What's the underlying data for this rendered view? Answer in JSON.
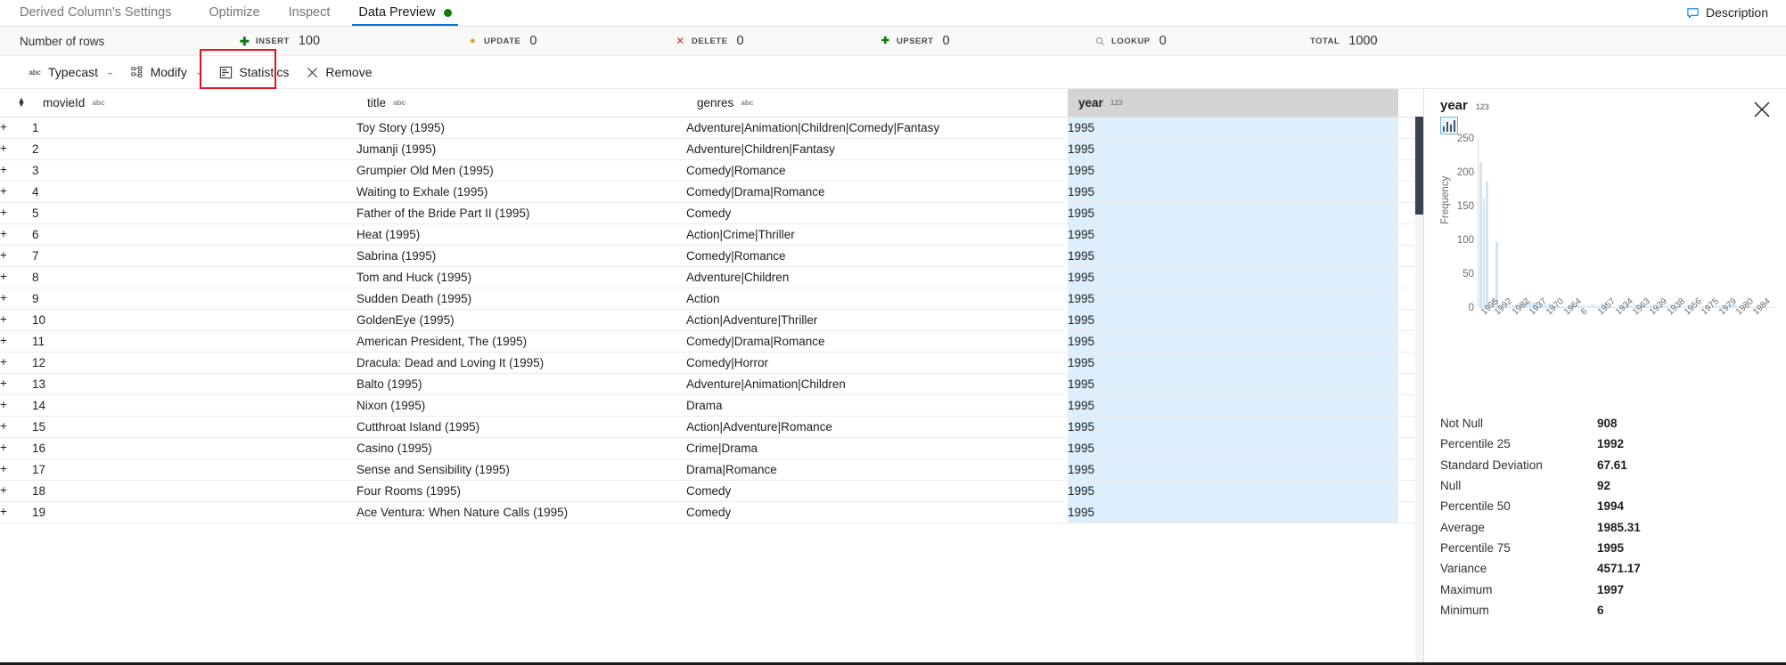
{
  "tabs": [
    {
      "label": "Derived Column's Settings",
      "active": false,
      "dot": false
    },
    {
      "label": "Optimize",
      "active": false,
      "dot": false
    },
    {
      "label": "Inspect",
      "active": false,
      "dot": false
    },
    {
      "label": "Data Preview",
      "active": true,
      "dot": true
    }
  ],
  "header": {
    "description_label": "Description"
  },
  "rowcount": {
    "label": "Number of rows",
    "metrics": [
      {
        "name": "INSERT",
        "value": "100",
        "icon": "plus-icon",
        "color": "#107c10",
        "glyph": "✚"
      },
      {
        "name": "UPDATE",
        "value": "0",
        "icon": "pencil-dot-icon",
        "color": "#d8a200",
        "glyph": "✦"
      },
      {
        "name": "DELETE",
        "value": "0",
        "icon": "cross-icon",
        "color": "#d13438",
        "glyph": "✕"
      },
      {
        "name": "UPSERT",
        "value": "0",
        "icon": "upsert-plus-icon",
        "color": "#107c10",
        "glyph": "✛"
      },
      {
        "name": "LOOKUP",
        "value": "0",
        "icon": "search-icon",
        "color": "#8a8886",
        "glyph": "⌕"
      },
      {
        "name": "TOTAL",
        "value": "1000",
        "icon": "none",
        "color": "#8a8886",
        "glyph": ""
      }
    ]
  },
  "column_toolbar": {
    "buttons": [
      {
        "label": "Typecast",
        "icon": "abc-icon",
        "chevron": true
      },
      {
        "label": "Modify",
        "icon": "modify-icon",
        "chevron": true
      },
      {
        "label": "Statistics",
        "icon": "statistics-icon",
        "chevron": false,
        "highlighted": true
      },
      {
        "label": "Remove",
        "icon": "close-icon",
        "chevron": false
      }
    ],
    "highlight_color": "#e81123"
  },
  "grid": {
    "columns": [
      {
        "name": "movieId",
        "type": "abc",
        "selected": false
      },
      {
        "name": "title",
        "type": "abc",
        "selected": false
      },
      {
        "name": "genres",
        "type": "abc",
        "selected": false
      },
      {
        "name": "year",
        "type": "123",
        "selected": true
      }
    ],
    "selected_color": "#ddeefc",
    "rows": [
      {
        "movieId": "1",
        "title": "Toy Story (1995)",
        "genres": "Adventure|Animation|Children|Comedy|Fantasy",
        "year": "1995"
      },
      {
        "movieId": "2",
        "title": "Jumanji (1995)",
        "genres": "Adventure|Children|Fantasy",
        "year": "1995"
      },
      {
        "movieId": "3",
        "title": "Grumpier Old Men (1995)",
        "genres": "Comedy|Romance",
        "year": "1995"
      },
      {
        "movieId": "4",
        "title": "Waiting to Exhale (1995)",
        "genres": "Comedy|Drama|Romance",
        "year": "1995"
      },
      {
        "movieId": "5",
        "title": "Father of the Bride Part II (1995)",
        "genres": "Comedy",
        "year": "1995"
      },
      {
        "movieId": "6",
        "title": "Heat (1995)",
        "genres": "Action|Crime|Thriller",
        "year": "1995"
      },
      {
        "movieId": "7",
        "title": "Sabrina (1995)",
        "genres": "Comedy|Romance",
        "year": "1995"
      },
      {
        "movieId": "8",
        "title": "Tom and Huck (1995)",
        "genres": "Adventure|Children",
        "year": "1995"
      },
      {
        "movieId": "9",
        "title": "Sudden Death (1995)",
        "genres": "Action",
        "year": "1995"
      },
      {
        "movieId": "10",
        "title": "GoldenEye (1995)",
        "genres": "Action|Adventure|Thriller",
        "year": "1995"
      },
      {
        "movieId": "11",
        "title": "American President, The (1995)",
        "genres": "Comedy|Drama|Romance",
        "year": "1995"
      },
      {
        "movieId": "12",
        "title": "Dracula: Dead and Loving It (1995)",
        "genres": "Comedy|Horror",
        "year": "1995"
      },
      {
        "movieId": "13",
        "title": "Balto (1995)",
        "genres": "Adventure|Animation|Children",
        "year": "1995"
      },
      {
        "movieId": "14",
        "title": "Nixon (1995)",
        "genres": "Drama",
        "year": "1995"
      },
      {
        "movieId": "15",
        "title": "Cutthroat Island (1995)",
        "genres": "Action|Adventure|Romance",
        "year": "1995"
      },
      {
        "movieId": "16",
        "title": "Casino (1995)",
        "genres": "Crime|Drama",
        "year": "1995"
      },
      {
        "movieId": "17",
        "title": "Sense and Sensibility (1995)",
        "genres": "Drama|Romance",
        "year": "1995"
      },
      {
        "movieId": "18",
        "title": "Four Rooms (1995)",
        "genres": "Comedy",
        "year": "1995"
      },
      {
        "movieId": "19",
        "title": "Ace Ventura: When Nature Calls (1995)",
        "genres": "Comedy",
        "year": "1995"
      }
    ]
  },
  "panel": {
    "column_name": "year",
    "column_type": "123",
    "histogram_toggle_icon": "histogram-icon",
    "close_icon": "close-icon",
    "statistics": [
      {
        "key": "Not Null",
        "value": "908"
      },
      {
        "key": "Percentile 25",
        "value": "1992"
      },
      {
        "key": "Standard Deviation",
        "value": "67.61"
      },
      {
        "key": "Null",
        "value": "92"
      },
      {
        "key": "Percentile 50",
        "value": "1994"
      },
      {
        "key": "Average",
        "value": "1985.31"
      },
      {
        "key": "Percentile 75",
        "value": "1995"
      },
      {
        "key": "Variance",
        "value": "4571.17"
      },
      {
        "key": "Maximum",
        "value": "1997"
      },
      {
        "key": "Minimum",
        "value": "6"
      }
    ]
  },
  "chart_data": {
    "type": "bar",
    "title": "",
    "xlabel": "",
    "ylabel": "Frequency",
    "ylim": [
      0,
      250
    ],
    "yticks": [
      0,
      50,
      100,
      150,
      200,
      250
    ],
    "grid": false,
    "legend": false,
    "bar_color": "#cfe5f7",
    "tick_labels": [
      "1995",
      "1992",
      "1982",
      "1937",
      "1970",
      "1964",
      "6",
      "1957",
      "1934",
      "1963",
      "1939",
      "1938",
      "1956",
      "1975",
      "1979",
      "1980",
      "1984"
    ],
    "tick_positions": [
      0,
      4,
      9,
      14,
      19,
      24,
      29,
      34,
      39,
      44,
      49,
      54,
      59,
      64,
      69,
      74,
      79
    ],
    "values": [
      216,
      162,
      187,
      3,
      15,
      98,
      2,
      1,
      1,
      2,
      4,
      5,
      4,
      7,
      10,
      11,
      8,
      9,
      6,
      3,
      5,
      6,
      4,
      2,
      3,
      2,
      1,
      2,
      4,
      4,
      4,
      4,
      3,
      3,
      5,
      4,
      2,
      6,
      5,
      2,
      1,
      1,
      1,
      2,
      3,
      5,
      4,
      6,
      5,
      3,
      4,
      3,
      5,
      3,
      2,
      4,
      2,
      4,
      5,
      5,
      3,
      4,
      2,
      3,
      2,
      2,
      1,
      1,
      2,
      4,
      2,
      4,
      3,
      3,
      4,
      2,
      5,
      6,
      4,
      2,
      1,
      1,
      2,
      1,
      1,
      1,
      1,
      1,
      1,
      1
    ]
  }
}
